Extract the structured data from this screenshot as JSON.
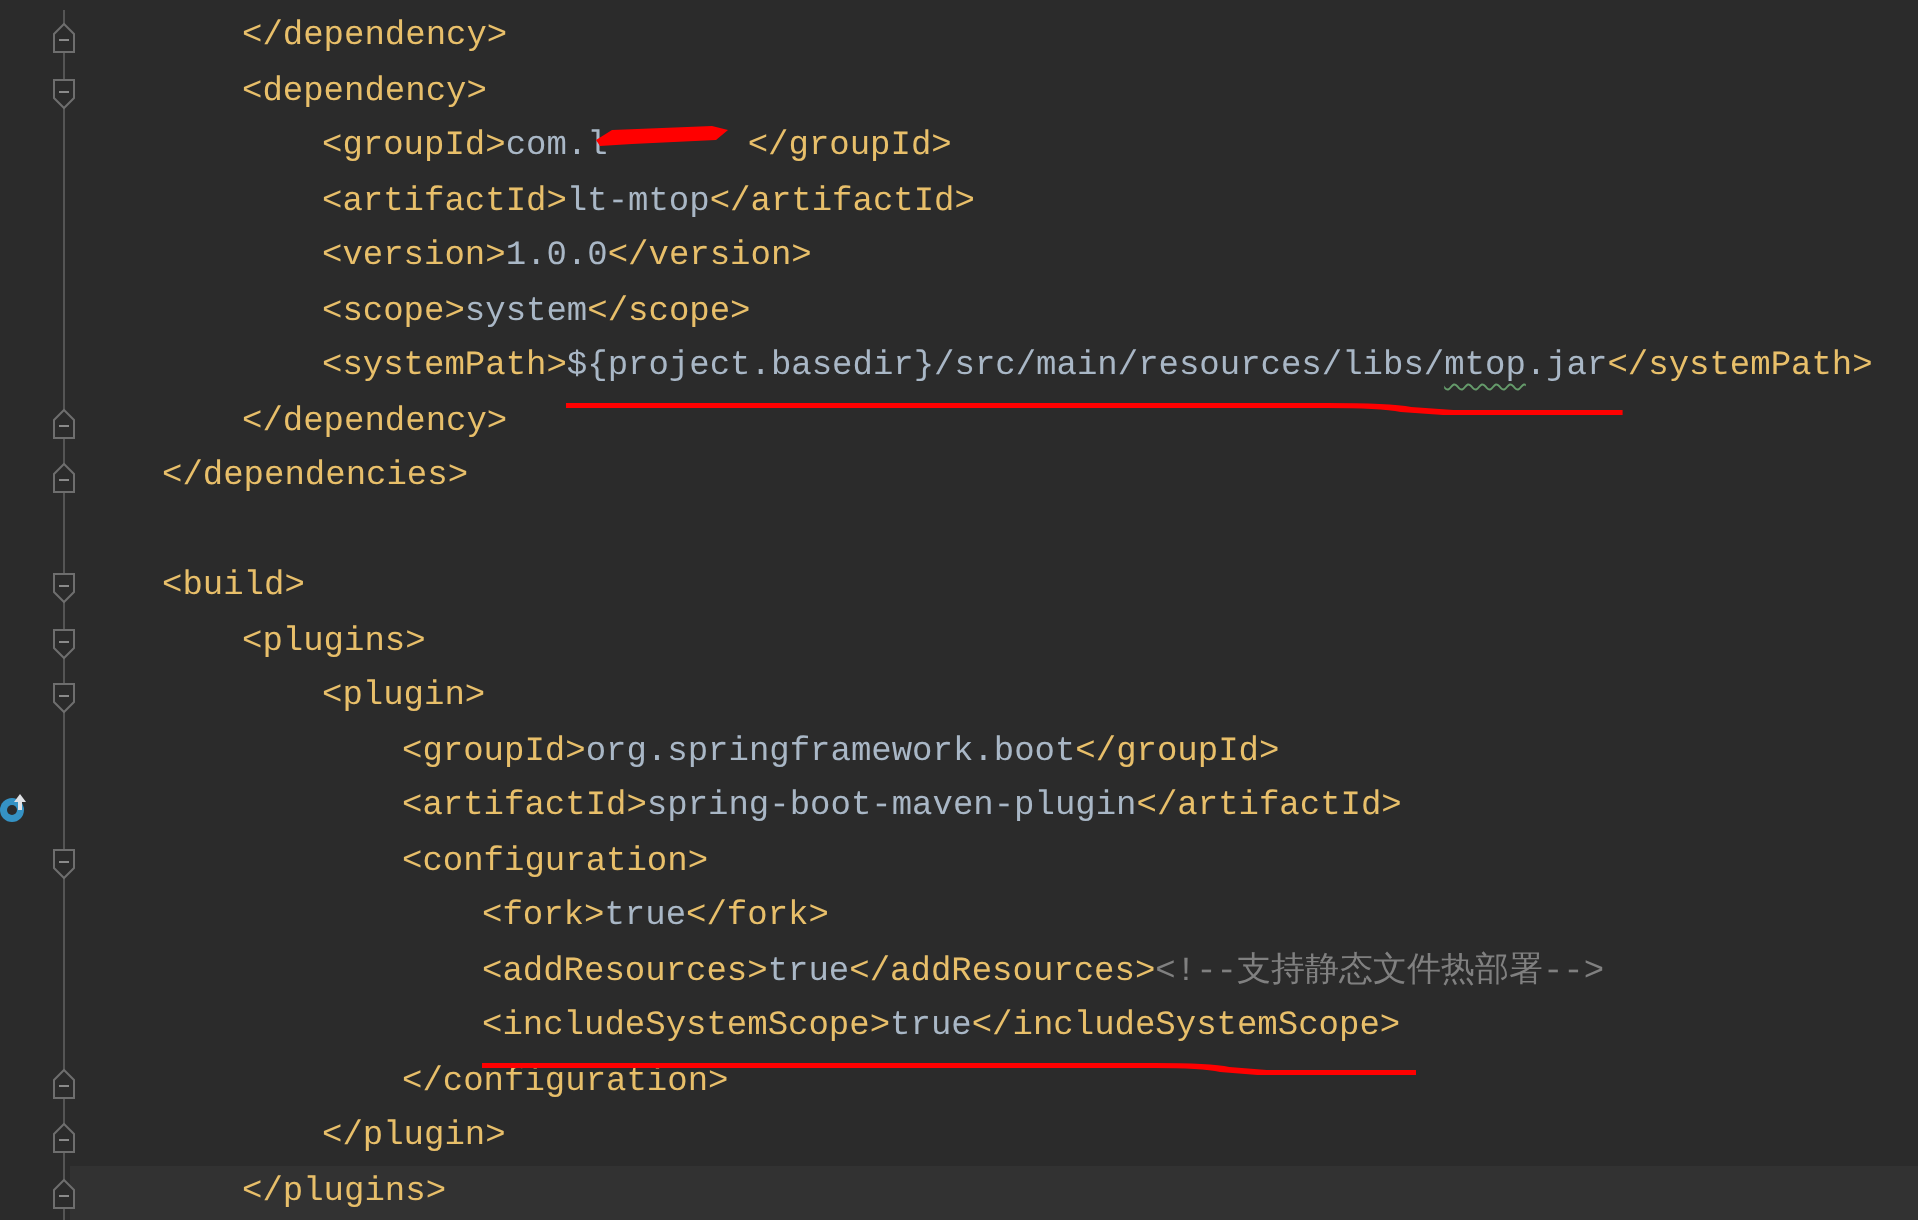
{
  "editor": {
    "lines": [
      {
        "children": [
          {
            "children": [
              {
                "fold_end": true,
                "tokens": [
                  {
                    "kind": "tag",
                    "text": "</dependency>"
                  }
                ]
              },
              {
                "fold_start": true,
                "tokens": [
                  {
                    "kind": "tag",
                    "text": "<dependency>"
                  }
                ],
                "children": [
                  {
                    "tokens": [
                      {
                        "kind": "tag",
                        "text": "<groupId>"
                      },
                      {
                        "kind": "text",
                        "text": "com.l"
                      },
                      {
                        "kind": "redacted"
                      },
                      {
                        "kind": "tag",
                        "text": "</groupId>"
                      }
                    ]
                  },
                  {
                    "tokens": [
                      {
                        "kind": "tag",
                        "text": "<artifactId>"
                      },
                      {
                        "kind": "text",
                        "text": "lt-mtop"
                      },
                      {
                        "kind": "tag",
                        "text": "</artifactId>"
                      }
                    ]
                  },
                  {
                    "tokens": [
                      {
                        "kind": "tag",
                        "text": "<version>"
                      },
                      {
                        "kind": "text",
                        "text": "1.0.0"
                      },
                      {
                        "kind": "tag",
                        "text": "</version>"
                      }
                    ]
                  },
                  {
                    "tokens": [
                      {
                        "kind": "tag",
                        "text": "<scope>"
                      },
                      {
                        "kind": "text",
                        "text": "system"
                      },
                      {
                        "kind": "tag",
                        "text": "</scope>"
                      }
                    ]
                  },
                  {
                    "tokens": [
                      {
                        "kind": "tag",
                        "text": "<systemPath>"
                      },
                      {
                        "kind": "text",
                        "text": "${project.basedir}/src/main/resources/libs/",
                        "underlined": true
                      },
                      {
                        "kind": "typo",
                        "text": "mtop",
                        "underlined": true
                      },
                      {
                        "kind": "text",
                        "text": ".jar",
                        "underlined": true
                      },
                      {
                        "kind": "tag",
                        "text": "</systemPath>"
                      }
                    ]
                  }
                ]
              },
              {
                "fold_end": true,
                "tokens": [
                  {
                    "kind": "tag",
                    "text": "</dependency>"
                  }
                ]
              }
            ]
          },
          {
            "fold_end": true,
            "tokens": [
              {
                "kind": "tag",
                "text": "</dependencies>"
              }
            ]
          },
          {
            "kind": "blank"
          },
          {
            "fold_start": true,
            "tokens": [
              {
                "kind": "tag",
                "text": "<build>"
              }
            ],
            "children": [
              {
                "fold_start": true,
                "tokens": [
                  {
                    "kind": "tag",
                    "text": "<plugins>"
                  }
                ],
                "children": [
                  {
                    "fold_start": true,
                    "tokens": [
                      {
                        "kind": "tag",
                        "text": "<plugin>"
                      }
                    ],
                    "children": [
                      {
                        "tokens": [
                          {
                            "kind": "tag",
                            "text": "<groupId>"
                          },
                          {
                            "kind": "text",
                            "text": "org.springframework.boot"
                          },
                          {
                            "kind": "tag",
                            "text": "</groupId>"
                          }
                        ]
                      },
                      {
                        "gutter_icon": true,
                        "tokens": [
                          {
                            "kind": "tag",
                            "text": "<artifactId>"
                          },
                          {
                            "kind": "text",
                            "text": "spring-boot-maven-plugin"
                          },
                          {
                            "kind": "tag",
                            "text": "</artifactId>"
                          }
                        ]
                      },
                      {
                        "fold_start": true,
                        "tokens": [
                          {
                            "kind": "tag",
                            "text": "<configuration>"
                          }
                        ],
                        "children": [
                          {
                            "tokens": [
                              {
                                "kind": "tag",
                                "text": "<fork>"
                              },
                              {
                                "kind": "text",
                                "text": "true"
                              },
                              {
                                "kind": "tag",
                                "text": "</fork>"
                              }
                            ]
                          },
                          {
                            "tokens": [
                              {
                                "kind": "tag",
                                "text": "<addResources>"
                              },
                              {
                                "kind": "text",
                                "text": "true"
                              },
                              {
                                "kind": "tag",
                                "text": "</addResources>"
                              },
                              {
                                "kind": "comment",
                                "text": "<!--支持静态文件热部署-->"
                              }
                            ]
                          },
                          {
                            "tokens": [
                              {
                                "kind": "tag",
                                "text": "<",
                                "underlined": true
                              },
                              {
                                "kind": "tag",
                                "text": "includeSystemScope>",
                                "underlined": true
                              },
                              {
                                "kind": "text",
                                "text": "true",
                                "underlined": true
                              },
                              {
                                "kind": "tag",
                                "text": "</includeSystemScope>",
                                "underlined": true
                              }
                            ]
                          }
                        ]
                      },
                      {
                        "fold_end": true,
                        "tokens": [
                          {
                            "kind": "tag",
                            "text": "</configuration>"
                          }
                        ]
                      }
                    ]
                  },
                  {
                    "fold_end": true,
                    "tokens": [
                      {
                        "kind": "tag",
                        "text": "</plugin>"
                      }
                    ]
                  }
                ]
              },
              {
                "fold_end": true,
                "current": true,
                "tokens": [
                  {
                    "kind": "tag",
                    "text": "</plugins>"
                  }
                ]
              }
            ]
          }
        ]
      }
    ]
  }
}
